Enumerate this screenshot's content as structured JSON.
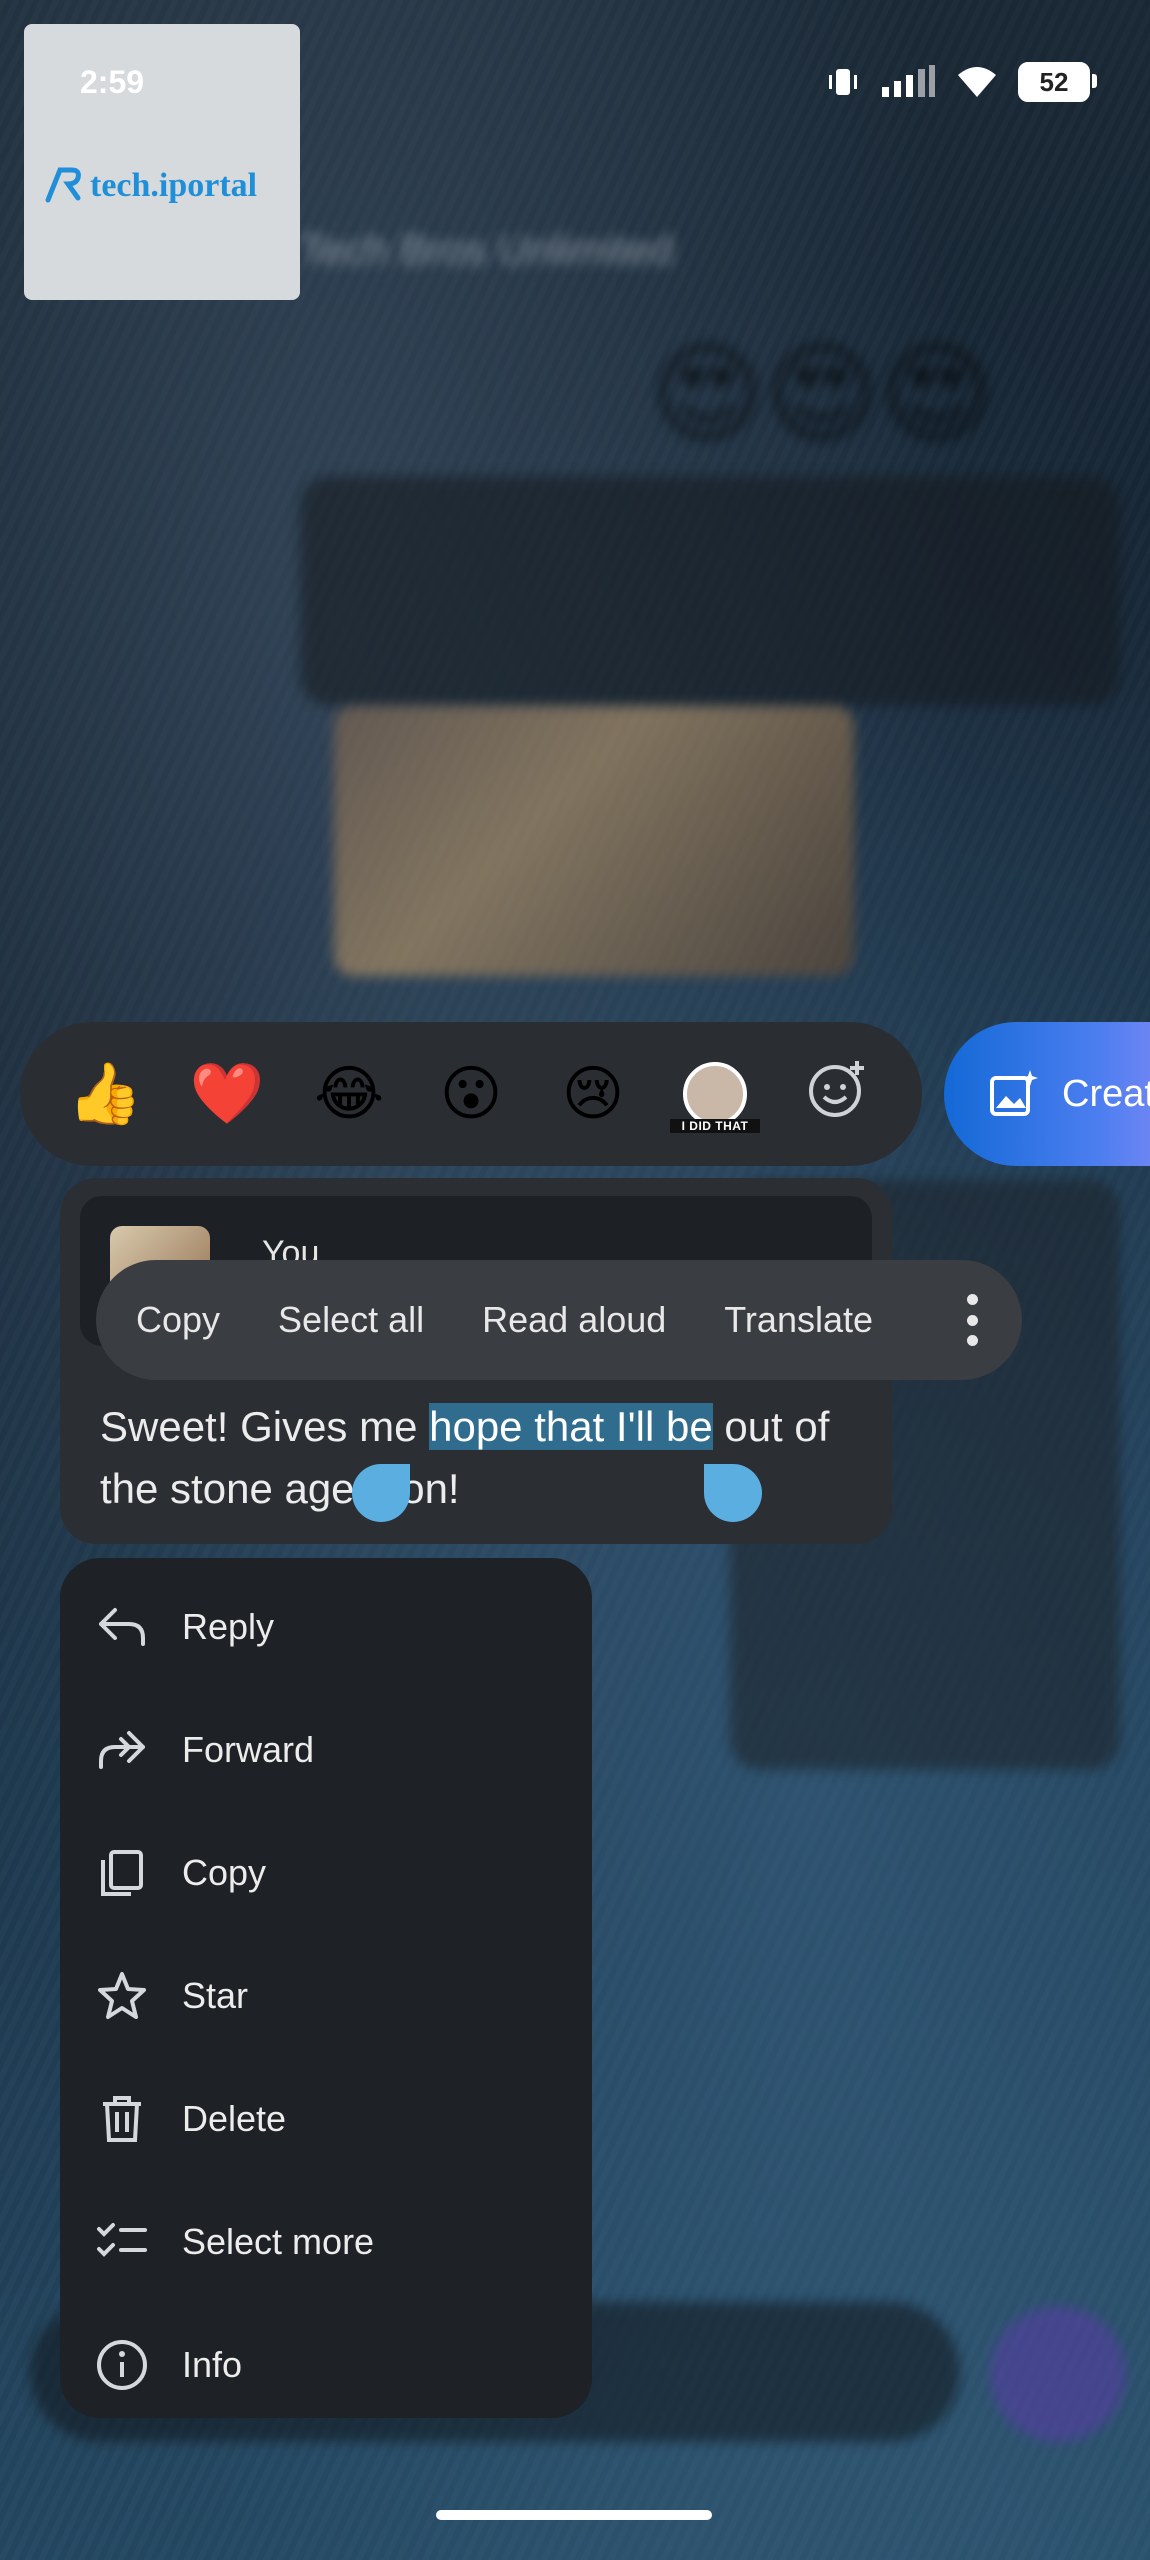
{
  "status": {
    "time": "2:59",
    "battery": "52"
  },
  "watermark": {
    "brand": "tech.iportal"
  },
  "chat": {
    "title": "Tech Bros Unlimited"
  },
  "reactions": {
    "emojis": [
      "👍",
      "❤️",
      "😂",
      "😮",
      "😢"
    ],
    "sticker_caption": "I DID THAT",
    "create_label": "Creat"
  },
  "message": {
    "quoted_sender": "You",
    "text_before": "Sweet! Gives me ",
    "text_selected": "hope that I'll be",
    "text_after": " out of the stone age... on!"
  },
  "text_toolbar": {
    "copy": "Copy",
    "select_all": "Select all",
    "read_aloud": "Read aloud",
    "translate": "Translate"
  },
  "menu": {
    "reply": "Reply",
    "forward": "Forward",
    "copy": "Copy",
    "star": "Star",
    "delete": "Delete",
    "select_more": "Select more",
    "info": "Info"
  }
}
